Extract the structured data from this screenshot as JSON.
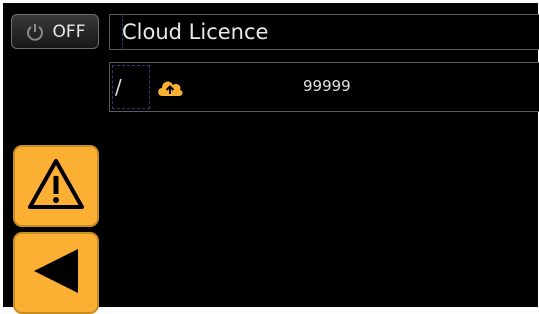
{
  "power": {
    "label": "OFF",
    "icon": "power-icon"
  },
  "header": {
    "title": "Cloud Licence"
  },
  "list": {
    "rows": [
      {
        "marker": "/",
        "icon": "cloud-upload-icon",
        "value": "99999"
      }
    ]
  },
  "side_buttons": [
    {
      "icon": "warning-icon"
    },
    {
      "icon": "back-arrow-icon"
    }
  ],
  "colors": {
    "accent": "#fbb033",
    "background": "#000000",
    "text": "#e8e8e8"
  }
}
